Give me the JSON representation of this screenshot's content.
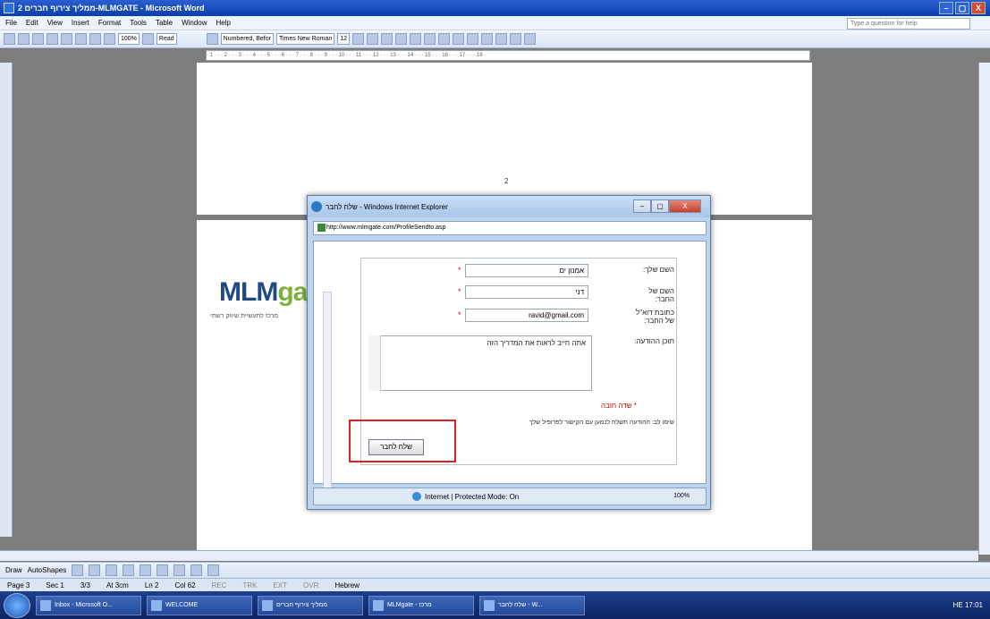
{
  "word": {
    "title": "2 ממליך צירוף חברים-MLMGATE - Microsoft Word",
    "window_buttons": [
      "–",
      "▢",
      "X"
    ],
    "menu": [
      "File",
      "Edit",
      "View",
      "Insert",
      "Format",
      "Tools",
      "Table",
      "Window",
      "Help"
    ],
    "help_placeholder": "Type a question for help",
    "toolbar": {
      "zoom": "100%",
      "read": "Read",
      "style": "Numbered, Befor",
      "font": "Times New Roman",
      "size": "12"
    },
    "page_number": "2",
    "logo_main": "MLM",
    "logo_accent": "gate",
    "logo_sub": "מרכז לתעשיית שיווק רשתי"
  },
  "popup": {
    "title": "שלח לחבר - Windows Internet Explorer",
    "close_label": "X",
    "min_label": "–",
    "max_label": "▢",
    "address": "http://www.mlmgate.com/ProfileSendto.asp",
    "form": {
      "sender_label": "השם שלך:",
      "sender_value": "אמנון ים",
      "friend_label": "השם של החבר:",
      "friend_value": "דני",
      "email_label": "כתובת דוא\"ל של החבר:",
      "email_value": "ravid@gmail.com",
      "message_label": "תוכן ההודעה:",
      "message_value": "אתה חייב לראות את המדריך הזה",
      "required_note": "* שדה חובה",
      "info_note": "שימו לב: ההודעה תשלח לנמען עם הקישור לפרופיל שלך",
      "send_button": "שלח לחבר"
    },
    "status": "Internet | Protected Mode: On",
    "zoom": "100%"
  },
  "statusbar": [
    "Page 3",
    "Sec 1",
    "3/3",
    "At 3cm",
    "Ln 2",
    "Col 62",
    "REC",
    "TRK",
    "EXT",
    "OVR",
    "Hebrew"
  ],
  "drawbar": {
    "draw": "Draw",
    "autoshapes": "AutoShapes"
  },
  "taskbar": {
    "tasks": [
      "Inbox - Microsoft O...",
      "WELCOME",
      "ממליך צירוף חברים",
      "MLMgate - מרכז",
      "שלח לחבר - W..."
    ],
    "clock": "HE 17:01"
  }
}
